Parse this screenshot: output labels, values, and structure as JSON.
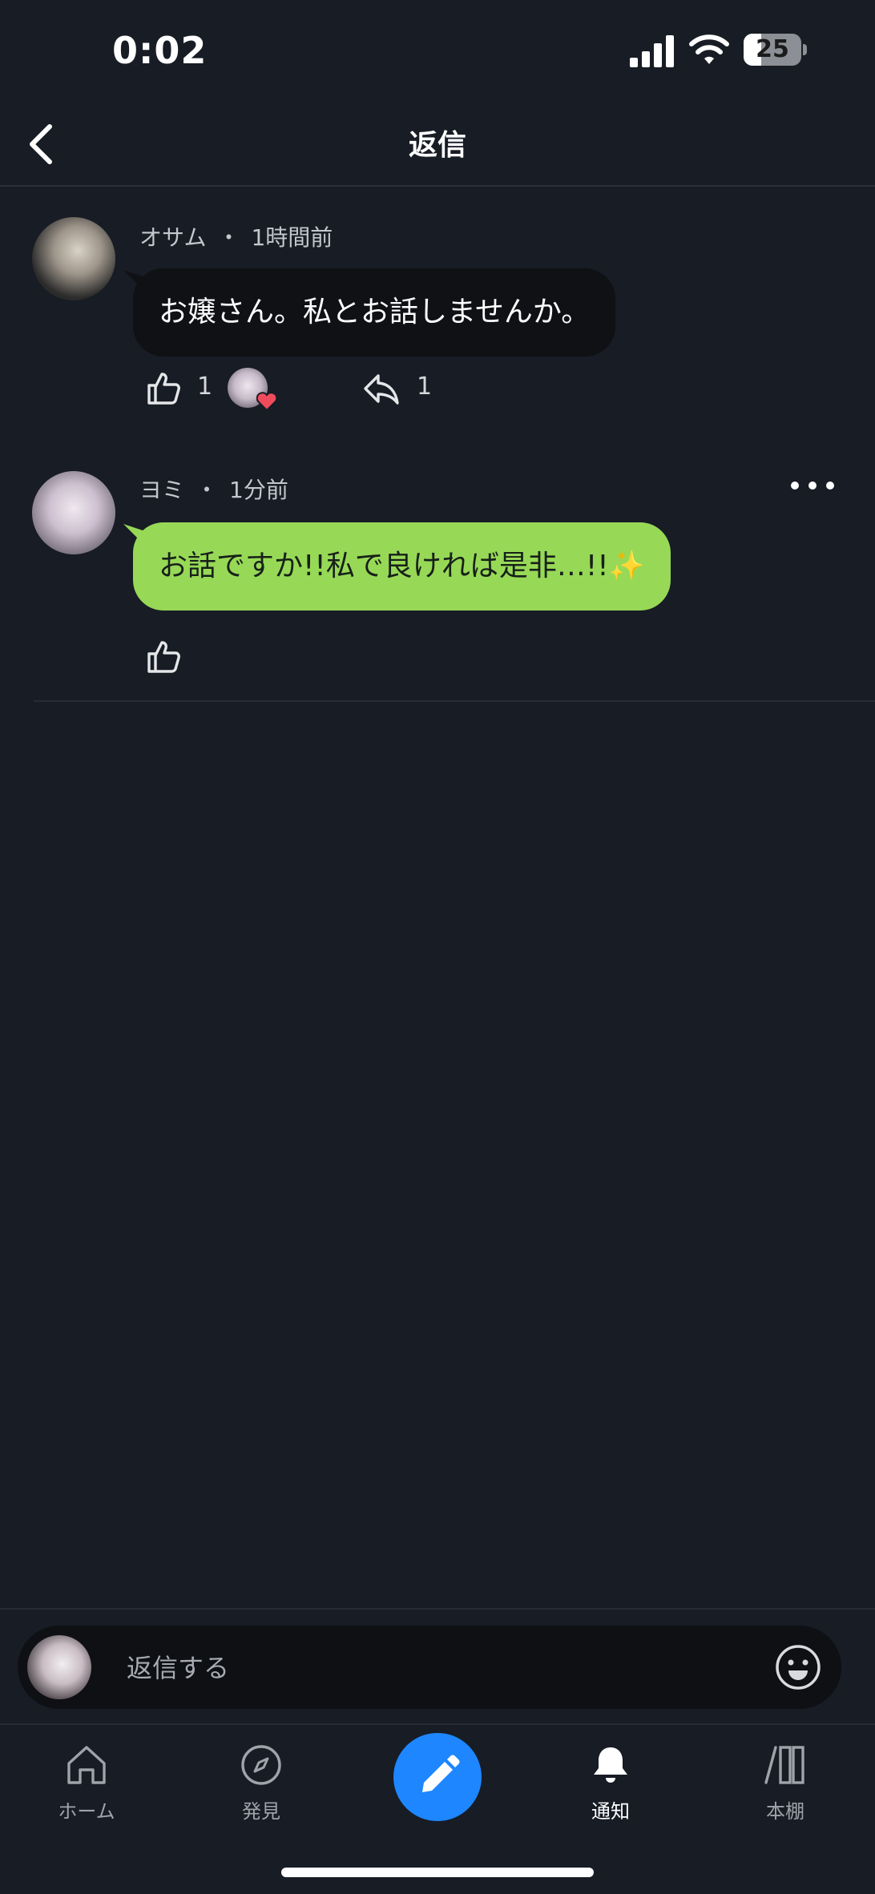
{
  "status_bar": {
    "time": "0:02",
    "battery": "25"
  },
  "header": {
    "title": "返信"
  },
  "comments": [
    {
      "author": "オサム",
      "separator": "・",
      "time": "1時間前",
      "text": "お嬢さん。私とお話しませんか。",
      "like_count": "1",
      "reply_count": "1"
    },
    {
      "author": "ヨミ",
      "separator": "・",
      "time": "1分前",
      "text": "お話ですか!!私で良ければ是非…!!✨"
    }
  ],
  "reply_bar": {
    "placeholder": "返信する"
  },
  "tabs": [
    {
      "label": "ホーム",
      "icon": "home-icon"
    },
    {
      "label": "発見",
      "icon": "compass-icon"
    },
    {
      "label": "",
      "icon": "pencil-icon"
    },
    {
      "label": "通知",
      "icon": "bell-icon"
    },
    {
      "label": "本棚",
      "icon": "bookshelf-icon"
    }
  ],
  "colors": {
    "background": "#171c25",
    "accent": "#1e86ff",
    "my_bubble": "#97d956",
    "other_bubble": "#0f1115"
  }
}
